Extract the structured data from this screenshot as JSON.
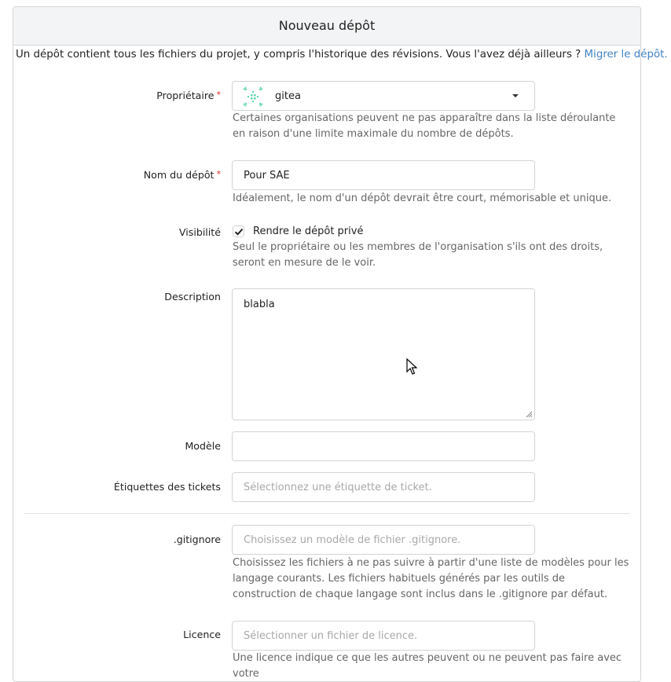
{
  "header": {
    "title": "Nouveau dépôt"
  },
  "intro": {
    "text": "Un dépôt contient tous les fichiers du projet, y compris l'historique des révisions. Vous l'avez déjà ailleurs ? ",
    "link": "Migrer le dépôt."
  },
  "owner": {
    "label": "Propriétaire",
    "required_mark": "*",
    "value": "gitea",
    "help": "Certaines organisations peuvent ne pas apparaître dans la liste déroulante en raison d'une limite maximale du nombre de dépôts."
  },
  "repo_name": {
    "label": "Nom du dépôt",
    "required_mark": "*",
    "value": "Pour SAE",
    "help": "Idéalement, le nom d'un dépôt devrait être court, mémorisable et unique."
  },
  "visibility": {
    "label": "Visibilité",
    "checkbox_label": "Rendre le dépôt privé",
    "checked": true,
    "help": "Seul le propriétaire ou les membres de l'organisation s'ils ont des droits, seront en mesure de le voir."
  },
  "description": {
    "label": "Description",
    "value": "blabla"
  },
  "template": {
    "label": "Modèle",
    "value": ""
  },
  "issue_labels": {
    "label": "Étiquettes des tickets",
    "placeholder": "Sélectionnez une étiquette de ticket."
  },
  "gitignore": {
    "label": ".gitignore",
    "placeholder": "Choisissez un modèle de fichier .gitignore.",
    "help": "Choisissez les fichiers à ne pas suivre à partir d'une liste de modèles pour les langage courants. Les fichiers habituels générés par les outils de construction de chaque langage sont inclus dans le .gitignore par défaut."
  },
  "license": {
    "label": "Licence",
    "placeholder": "Sélectionner un fichier de licence.",
    "help": "Une licence indique ce que les autres peuvent ou ne peuvent pas faire avec votre"
  },
  "colors": {
    "link": "#4183c4",
    "required": "#db2828",
    "avatar": "#5ed6a8"
  }
}
